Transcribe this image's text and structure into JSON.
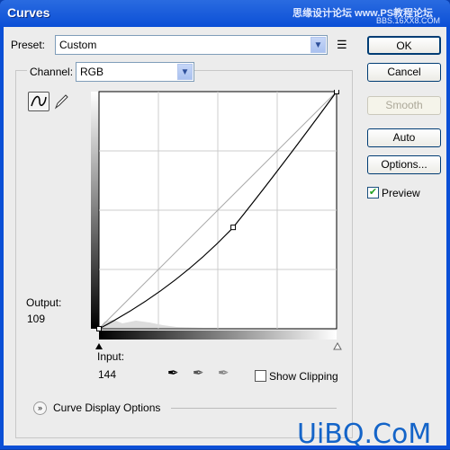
{
  "window": {
    "title": "Curves",
    "watermark_top": "思缘设计论坛 www.PS教程论坛",
    "watermark_sub": "BBS.16XX8.COM",
    "watermark_bottom": "UiBQ.CoM"
  },
  "preset": {
    "label": "Preset:",
    "value": "Custom"
  },
  "channel": {
    "label": "Channel:",
    "value": "RGB"
  },
  "buttons": {
    "ok": "OK",
    "cancel": "Cancel",
    "smooth": "Smooth",
    "auto": "Auto",
    "options": "Options..."
  },
  "preview": {
    "label": "Preview",
    "checked": true
  },
  "output": {
    "label": "Output:",
    "value": "109"
  },
  "input": {
    "label": "Input:",
    "value": "144"
  },
  "show_clipping": {
    "label": "Show Clipping",
    "checked": false
  },
  "curve_display_options": "Curve Display Options",
  "curve": {
    "points": [
      [
        0,
        0
      ],
      [
        144,
        109
      ],
      [
        255,
        255
      ]
    ]
  },
  "colors": {
    "title_bar": "#0b4fd6",
    "dialog": "#ececec"
  }
}
